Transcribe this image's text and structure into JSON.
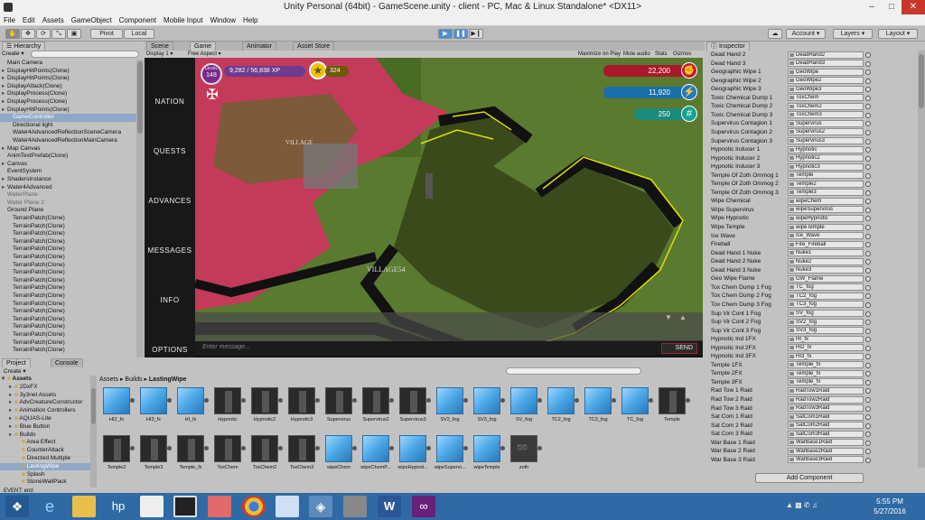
{
  "window": {
    "title": "Unity Personal (64bit) - GameScene.unity - client - PC, Mac & Linux Standalone* <DX11>"
  },
  "menu": [
    "File",
    "Edit",
    "Assets",
    "GameObject",
    "Component",
    "Mobile Input",
    "Window",
    "Help"
  ],
  "toolbar": {
    "pivot": "Pivot",
    "local": "Local",
    "account": "Account",
    "layers": "Layers",
    "layout": "Layout"
  },
  "hierarchy": {
    "tab": "Hierarchy",
    "create": "Create",
    "items": [
      "Main Camera",
      "DisplayHitPoints(Clone)",
      "DisplayHitPoints(Clone)",
      "DisplayAttack(Clone)",
      "DisplayProcess(Clone)",
      "DisplayProcess(Clone)",
      "DisplayHitPoints(Clone)",
      "GameController",
      "Directional light",
      "Water4AdvancedReflectionSceneCamera",
      "Water4AdvancedReflectionMainCamera",
      "Map Canvas",
      "AnimTextPrefab(Clone)",
      "Canvas",
      "EventSystem",
      "ShadersInstance",
      "Water4Advanced",
      "WaterPlane",
      "Water Plane 2",
      "Ground Plane",
      "TerrainPatch(Clone)",
      "TerrainPatch(Clone)",
      "TerrainPatch(Clone)",
      "TerrainPatch(Clone)",
      "TerrainPatch(Clone)",
      "TerrainPatch(Clone)",
      "TerrainPatch(Clone)",
      "TerrainPatch(Clone)",
      "TerrainPatch(Clone)",
      "TerrainPatch(Clone)",
      "TerrainPatch(Clone)",
      "TerrainPatch(Clone)",
      "TerrainPatch(Clone)",
      "TerrainPatch(Clone)",
      "TerrainPatch(Clone)",
      "TerrainPatch(Clone)",
      "TerrainPatch(Clone)",
      "TerrainPatch(Clone)"
    ]
  },
  "scene_tabs": {
    "scene": "Scene",
    "game": "Game",
    "animator": "Animator",
    "asset_store": "Asset Store"
  },
  "game_bar": {
    "display": "Display 1",
    "aspect": "Free Aspect",
    "maximize": "Maximize on Play",
    "mute": "Mute audio",
    "stats": "Stats",
    "gizmos": "Gizmos"
  },
  "game": {
    "nav": [
      "NATION",
      "QUESTS",
      "ADVANCES",
      "MESSAGES",
      "INFO",
      "OPTIONS"
    ],
    "level_label": "LEVEL",
    "level": "148",
    "xp": "9,282 / 56,838 XP",
    "stars": "324",
    "hud1": "22,200",
    "hud2": "11,920",
    "hud3": "250",
    "village1": "VILLAGE",
    "village2": "VILLAGE54",
    "message_placeholder": "Enter message...",
    "send": "SEND"
  },
  "project": {
    "tab": "Project",
    "console": "Console",
    "create": "Create",
    "breadcrumb": [
      "Assets",
      "Builds",
      "LastingWipe"
    ],
    "tree": [
      "Assets",
      "2DxFX",
      "3y3net Assets",
      "AdvCreatureConstructor",
      "Animation Controllers",
      "AQUAS-Lite",
      "Blue Button",
      "Builds",
      "Area Effect",
      "CounterAttack",
      "Directed Multiple",
      "LastingWipe",
      "Splash",
      "StoneWallPack"
    ],
    "assets_row1": [
      [
        "HI2_fx",
        "cube"
      ],
      [
        "HI3_fx",
        "cube"
      ],
      [
        "HI_fx",
        "cube"
      ],
      [
        "Hypnotic",
        "dark"
      ],
      [
        "Hypnotic2",
        "dark"
      ],
      [
        "Hypnotic3",
        "dark"
      ],
      [
        "Supervirus",
        "dark"
      ],
      [
        "Supervirus2",
        "dark"
      ],
      [
        "Supervirus3",
        "dark"
      ],
      [
        "SV2_fog",
        "cube"
      ],
      [
        "SV3_fog",
        "cube"
      ],
      [
        "SV_fog",
        "cube"
      ],
      [
        "TC2_fog",
        "cube"
      ],
      [
        "TC3_fog",
        "cube"
      ],
      [
        "TC_fog",
        "cube"
      ],
      [
        "Temple",
        "dark"
      ]
    ],
    "assets_row2": [
      [
        "Temple2",
        "dark"
      ],
      [
        "Temple3",
        "dark"
      ],
      [
        "Temple_fx",
        "darkp"
      ],
      [
        "ToxChem",
        "dark"
      ],
      [
        "ToxChem2",
        "dark"
      ],
      [
        "ToxChem3",
        "dark"
      ],
      [
        "wipeChem",
        "cube"
      ],
      [
        "wipeChemP...",
        "cube"
      ],
      [
        "wipeHypnot...",
        "cube"
      ],
      [
        "wipeSupervi...",
        "cube"
      ],
      [
        "wipeTemple",
        "cube"
      ],
      [
        "zoth",
        "zoth"
      ]
    ]
  },
  "status": {
    "text": "EVENT: end"
  },
  "inspector": {
    "tab": "Inspector",
    "add_component": "Add Component",
    "rows": [
      [
        "Dead Hand 2",
        "DeadHand2"
      ],
      [
        "Dead Hand 3",
        "DeadHand3"
      ],
      [
        "Geographic Wipe 1",
        "GeoWipe"
      ],
      [
        "Geographic Wipe 2",
        "GeoWipe2"
      ],
      [
        "Geographic Wipe 3",
        "GeoWipe3"
      ],
      [
        "Toxic Chemical Dump 1",
        "ToxChem"
      ],
      [
        "Toxic Chemical Dump 2",
        "ToxChem2"
      ],
      [
        "Toxic Chemical Dump 3",
        "ToxChem3"
      ],
      [
        "Supervirus Contagion 1",
        "Supervirus"
      ],
      [
        "Supervirus Contagion 2",
        "Supervirus2"
      ],
      [
        "Supervirus Contagion 3",
        "Supervirus3"
      ],
      [
        "Hypnotic Inducer 1",
        "Hypnotic"
      ],
      [
        "Hypnotic Inducer 2",
        "Hypnotic2"
      ],
      [
        "Hypnotic Inducer 3",
        "Hypnotic3"
      ],
      [
        "Temple Of Zoth Ommog 1",
        "Temple"
      ],
      [
        "Temple Of Zoth Ommog 2",
        "Temple2"
      ],
      [
        "Temple Of Zoth Ommog 3",
        "Temple3"
      ],
      [
        "Wipe Chemical",
        "wipeChem"
      ],
      [
        "Wipe Supervirus",
        "wipeSupervirus"
      ],
      [
        "Wipe Hypnotic",
        "wipeHypnotic"
      ],
      [
        "Wipe Temple",
        "wipeTemple"
      ],
      [
        "Ice Wave",
        "Ice_Wave"
      ],
      [
        "Fireball",
        "Fire_Fireball"
      ],
      [
        "Dead Hand 1 Nuke",
        "Nuke1"
      ],
      [
        "Dead Hand 2 Nuke",
        "Nuke2"
      ],
      [
        "Dead Hand 3 Nuke",
        "Nuke3"
      ],
      [
        "Geo Wipe Flame",
        "GW_Flame"
      ],
      [
        "Tox Chem Dump 1 Fog",
        "TC_fog"
      ],
      [
        "Tox Chem Dump 2 Fog",
        "TC2_fog"
      ],
      [
        "Tox Chem Dump 3 Fog",
        "TC3_fog"
      ],
      [
        "Sup Vir Cont 1 Fog",
        "SV_fog"
      ],
      [
        "Sup Vir Cont 2 Fog",
        "SV2_fog"
      ],
      [
        "Sup Vir Cont 3 Fog",
        "SV3_fog"
      ],
      [
        "Hypnotic Ind 1FX",
        "HI_fx"
      ],
      [
        "Hypnotic Ind 2FX",
        "HI2_fx"
      ],
      [
        "Hypnotic Ind 3FX",
        "HI3_fx"
      ],
      [
        "Temple 1FX",
        "Temple_fx"
      ],
      [
        "Temple 2FX",
        "Temple_fx"
      ],
      [
        "Temple 3FX",
        "Temple_fx"
      ],
      [
        "Rad Tow 1 Raid",
        "RadTow1Raid"
      ],
      [
        "Rad Tow 2 Raid",
        "RadTow2Raid"
      ],
      [
        "Rad Tow 3 Raid",
        "RadTow3Raid"
      ],
      [
        "Sat Com 1 Raid",
        "SatCom1Raid"
      ],
      [
        "Sat Com 2 Raid",
        "SatCom2Raid"
      ],
      [
        "Sat Com 3 Raid",
        "SatCom3Raid"
      ],
      [
        "War Base 1 Raid",
        "WarBase1Raid"
      ],
      [
        "War Base 2 Raid",
        "WarBase2Raid"
      ],
      [
        "War Base 3 Raid",
        "WarBase3Raid"
      ]
    ]
  },
  "taskbar": {
    "time": "5:55 PM",
    "date": "5/27/2016"
  }
}
